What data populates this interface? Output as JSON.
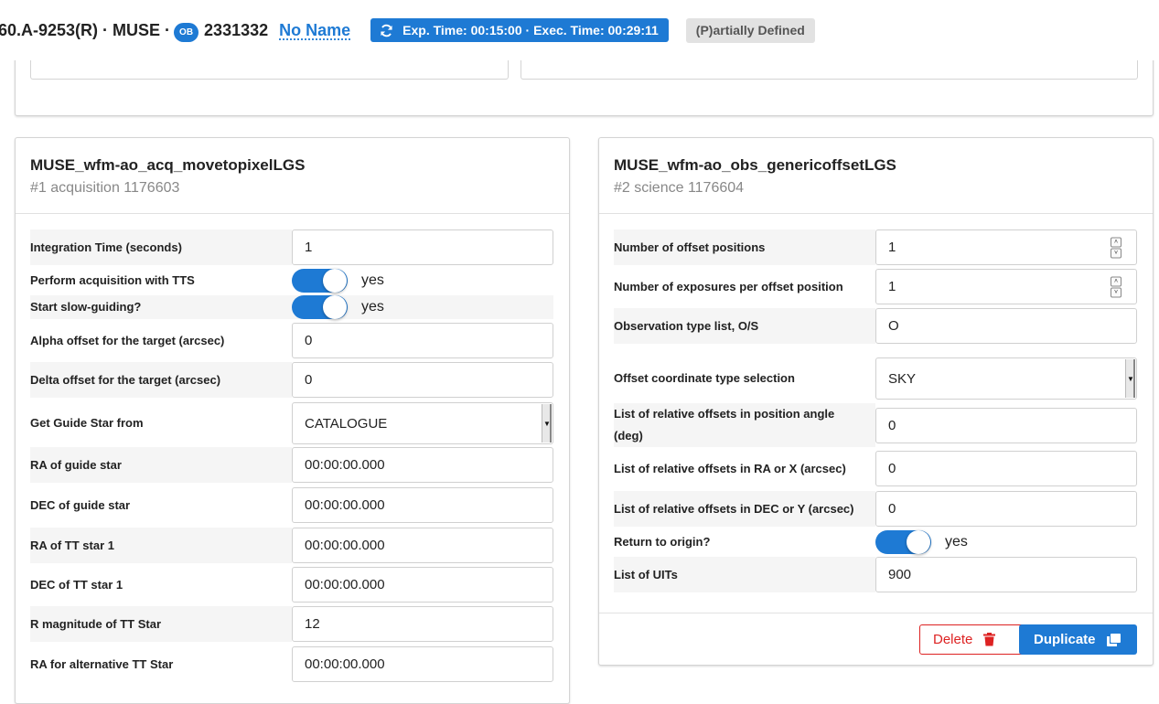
{
  "header": {
    "program": "60.A-9253(R) · MUSE ·",
    "ob_badge": "OB",
    "ob_id": "2331332",
    "ob_name": "No Name",
    "exposure": "Exp. Time: 00:15:00 · Exec. Time: 00:29:11",
    "status": "(P)artially Defined"
  },
  "left_card": {
    "title": "MUSE_wfm-ao_acq_movetopixelLGS",
    "subtitle": "#1 acquisition 1176603",
    "rows": [
      {
        "label": "Integration Time (seconds)",
        "value": "1"
      },
      {
        "label": "Perform acquisition with TTS",
        "value": "yes"
      },
      {
        "label": "Start slow-guiding?",
        "value": "yes"
      },
      {
        "label": "Alpha offset for the target (arcsec)",
        "value": "0"
      },
      {
        "label": "Delta offset for the target (arcsec)",
        "value": "0"
      },
      {
        "label": "Get Guide Star from",
        "value": "CATALOGUE"
      },
      {
        "label": "RA of guide star",
        "value": "00:00:00.000"
      },
      {
        "label": "DEC of guide star",
        "value": "00:00:00.000"
      },
      {
        "label": "RA of TT star 1",
        "value": "00:00:00.000"
      },
      {
        "label": "DEC of TT star 1",
        "value": "00:00:00.000"
      },
      {
        "label": "R magnitude of TT Star",
        "value": "12"
      },
      {
        "label": "RA for alternative TT Star",
        "value": "00:00:00.000"
      }
    ]
  },
  "right_card": {
    "title": "MUSE_wfm-ao_obs_genericoffsetLGS",
    "subtitle": "#2 science 1176604",
    "rows": [
      {
        "label": "Number of offset positions",
        "value": "1"
      },
      {
        "label": "Number of exposures per offset position",
        "value": "1"
      },
      {
        "label": "Observation type list, O/S",
        "value": "O"
      },
      {
        "label": "Offset coordinate type selection",
        "value": "SKY"
      },
      {
        "label": "List of relative offsets in position angle (deg)",
        "value": "0"
      },
      {
        "label": "List of relative offsets in RA or X (arcsec)",
        "value": "0"
      },
      {
        "label": "List of relative offsets in DEC or Y (arcsec)",
        "value": "0"
      },
      {
        "label": "Return to origin?",
        "value": "yes"
      },
      {
        "label": "List of UITs",
        "value": "900"
      }
    ],
    "delete_label": "Delete",
    "duplicate_label": "Duplicate"
  },
  "colors": {
    "accent": "#1e7ad4",
    "danger": "#dd2222",
    "muted_badge": "#e2e2e2"
  }
}
